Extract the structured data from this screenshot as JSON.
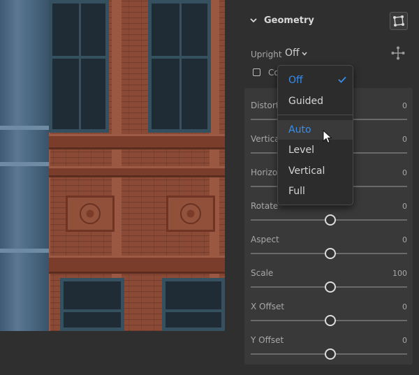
{
  "panel": {
    "title": "Geometry",
    "upright": {
      "label": "Upright",
      "value": "Off"
    },
    "checkbox_label": "Co",
    "sliders": [
      {
        "label": "Distorti",
        "value": "0"
      },
      {
        "label": "Vertica",
        "value": "0"
      },
      {
        "label": "Horizon",
        "value": "0"
      },
      {
        "label": "Rotate",
        "value": "0"
      },
      {
        "label": "Aspect",
        "value": "0"
      },
      {
        "label": "Scale",
        "value": "100"
      },
      {
        "label": "X Offset",
        "value": "0"
      },
      {
        "label": "Y Offset",
        "value": "0"
      }
    ]
  },
  "menu": {
    "items": [
      {
        "label": "Off",
        "state": "selected"
      },
      {
        "label": "Guided",
        "state": ""
      },
      {
        "label": "Auto",
        "state": "hover"
      },
      {
        "label": "Level",
        "state": ""
      },
      {
        "label": "Vertical",
        "state": ""
      },
      {
        "label": "Full",
        "state": ""
      }
    ]
  },
  "colors": {
    "accent": "#3b8ee8",
    "panel_bg": "#2f2f2f",
    "slider_box_bg": "#393939"
  },
  "icons": {
    "header_chevron": "chevron-down-icon",
    "geometry_button": "guided-upright-icon",
    "upright_caret": "caret-down-icon",
    "move_tool": "move-icon",
    "checkmark": "checkmark-icon",
    "cursor": "pointer-cursor-icon"
  }
}
